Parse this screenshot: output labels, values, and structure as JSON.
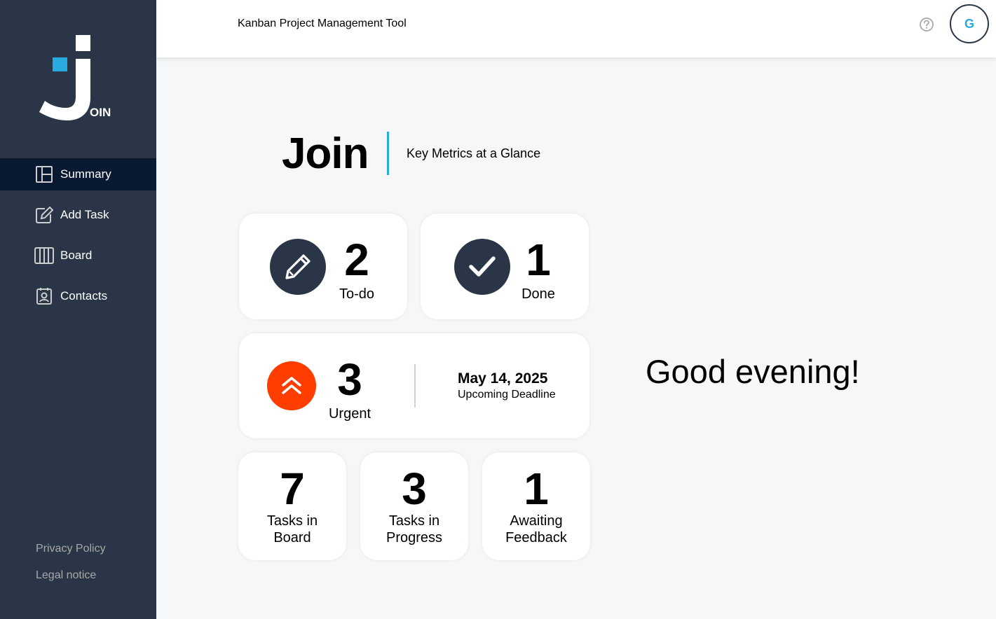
{
  "app": {
    "logo_text": "OIN",
    "header_title": "Kanban Project Management Tool",
    "user_initial": "G"
  },
  "sidebar": {
    "items": [
      {
        "label": "Summary",
        "icon": "summary-icon",
        "active": true
      },
      {
        "label": "Add Task",
        "icon": "add-task-icon",
        "active": false
      },
      {
        "label": "Board",
        "icon": "board-icon",
        "active": false
      },
      {
        "label": "Contacts",
        "icon": "contacts-icon",
        "active": false
      }
    ],
    "footer": {
      "privacy": "Privacy Policy",
      "legal": "Legal notice"
    }
  },
  "summary": {
    "title": "Join",
    "subtitle": "Key Metrics at a Glance",
    "todo": {
      "count": "2",
      "label": "To-do"
    },
    "done": {
      "count": "1",
      "label": "Done"
    },
    "urgent": {
      "count": "3",
      "label": "Urgent"
    },
    "deadline": {
      "date": "May 14, 2025",
      "label": "Upcoming Deadline"
    },
    "tasks_in_board": {
      "count": "7",
      "label_line1": "Tasks in",
      "label_line2": "Board"
    },
    "tasks_in_progress": {
      "count": "3",
      "label_line1": "Tasks in",
      "label_line2": "Progress"
    },
    "awaiting_feedback": {
      "count": "1",
      "label_line1": "Awaiting",
      "label_line2": "Feedback"
    },
    "greeting": "Good evening!"
  },
  "colors": {
    "sidebar_bg": "#2a3647",
    "sidebar_active": "#091931",
    "accent_blue": "#29abe2",
    "urgent_orange": "#ff3d00",
    "icon_circle": "#2a3647"
  }
}
